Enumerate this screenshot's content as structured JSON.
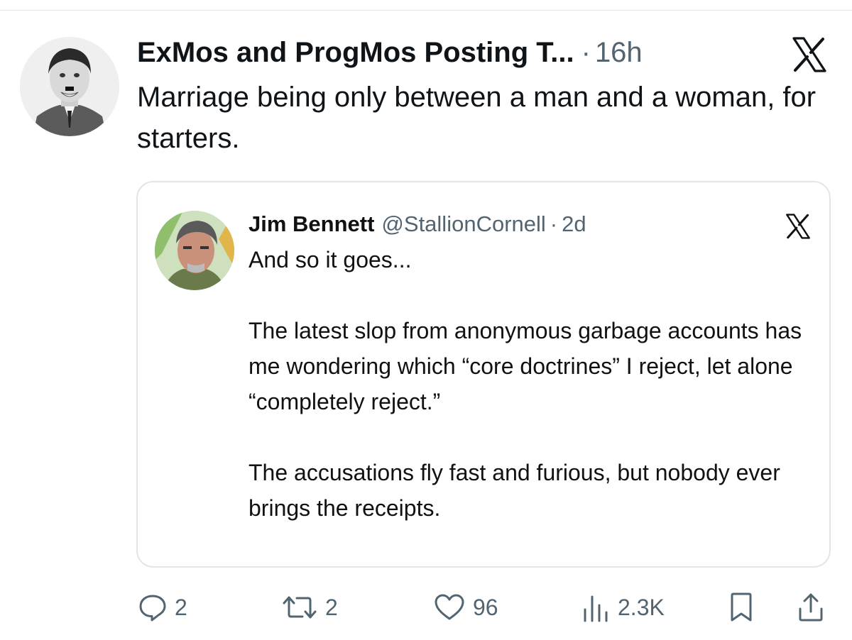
{
  "post": {
    "author_name": "ExMos and ProgMos Posting T...",
    "dot": "·",
    "time": "16h",
    "text": "Marriage being only between a man and a woman, for starters."
  },
  "quote": {
    "author_name": "Jim Bennett",
    "handle": "@StallionCornell",
    "dot": "·",
    "time": "2d",
    "paragraphs": [
      "And so it goes...",
      "The latest slop from anonymous garbage accounts has me wondering which “core doctrines” I reject, let alone “completely reject.”",
      "The accusations fly fast and furious, but nobody ever brings the receipts."
    ]
  },
  "actions": {
    "replies": "2",
    "reposts": "2",
    "likes": "96",
    "views": "2.3K"
  },
  "icons": {
    "brand": "x-logo-icon",
    "reply": "reply-icon",
    "repost": "repost-icon",
    "like": "heart-icon",
    "views": "views-icon",
    "bookmark": "bookmark-icon",
    "share": "share-icon"
  },
  "colors": {
    "text": "#0f1419",
    "muted": "#536471",
    "border": "#e3e6e8"
  }
}
